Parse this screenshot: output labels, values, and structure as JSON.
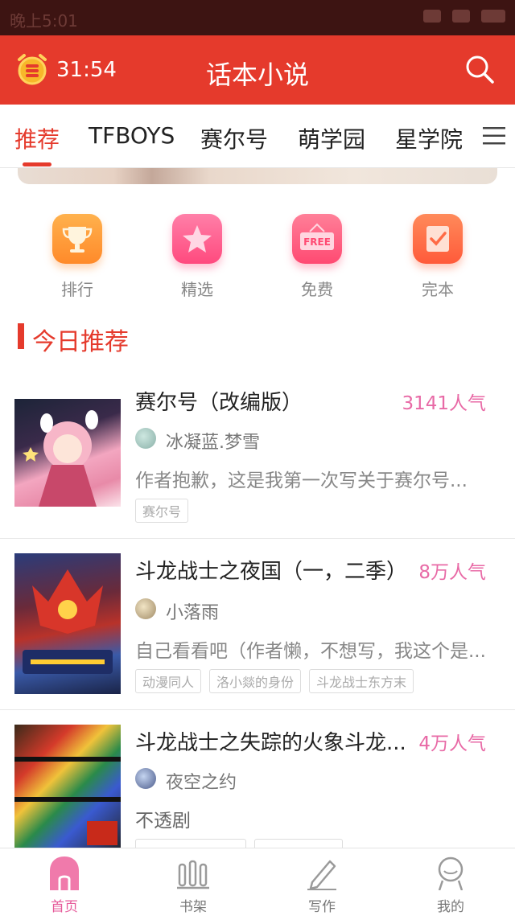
{
  "status_bar": {
    "time": "晚上5:01"
  },
  "header": {
    "timer": "31:54",
    "title": "话本小说",
    "timer_icon": "alarm-clock-coin-icon",
    "search_icon": "search-icon",
    "accent": "#e53a2c"
  },
  "tabs": [
    {
      "label": "推荐",
      "active": true
    },
    {
      "label": "TFBOYS"
    },
    {
      "label": "赛尔号"
    },
    {
      "label": "萌学园"
    },
    {
      "label": "星学院"
    }
  ],
  "categories": [
    {
      "label": "排行",
      "icon": "trophy-icon",
      "color": "#ff9a3c"
    },
    {
      "label": "精选",
      "icon": "star-icon",
      "color": "#ff5e8e"
    },
    {
      "label": "免费",
      "icon": "free-sign-icon",
      "color": "#ff5e80",
      "icon_text": "FREE"
    },
    {
      "label": "完本",
      "icon": "checklist-icon",
      "color": "#ff6a45"
    }
  ],
  "section": {
    "title": "今日推荐"
  },
  "books": [
    {
      "title": "赛尔号（改编版）",
      "popularity": "3141人气",
      "author": "冰凝蓝.梦雪",
      "description": "作者抱歉，这是我第一次写关于赛尔号...",
      "tags": [
        "赛尔号"
      ]
    },
    {
      "title": "斗龙战士之夜国（一，二季）",
      "popularity": "8万人气",
      "author": "小落雨",
      "description": "自己看看吧（作者懒，不想写，我这个是...",
      "tags": [
        "动漫同人",
        "洛小燚的身份",
        "斗龙战士东方末"
      ]
    },
    {
      "title": "斗龙战士之失踪的火象斗龙...",
      "popularity": "4万人气",
      "author": "夜空之约",
      "description": "不透剧",
      "tags": []
    }
  ],
  "bottom_nav": [
    {
      "label": "首页",
      "icon": "home-icon",
      "active": true
    },
    {
      "label": "书架",
      "icon": "bookshelf-icon"
    },
    {
      "label": "写作",
      "icon": "pencil-icon"
    },
    {
      "label": "我的",
      "icon": "profile-icon"
    }
  ],
  "colors": {
    "popularity": "#e86aa6",
    "nav_active": "#e65a9a"
  }
}
